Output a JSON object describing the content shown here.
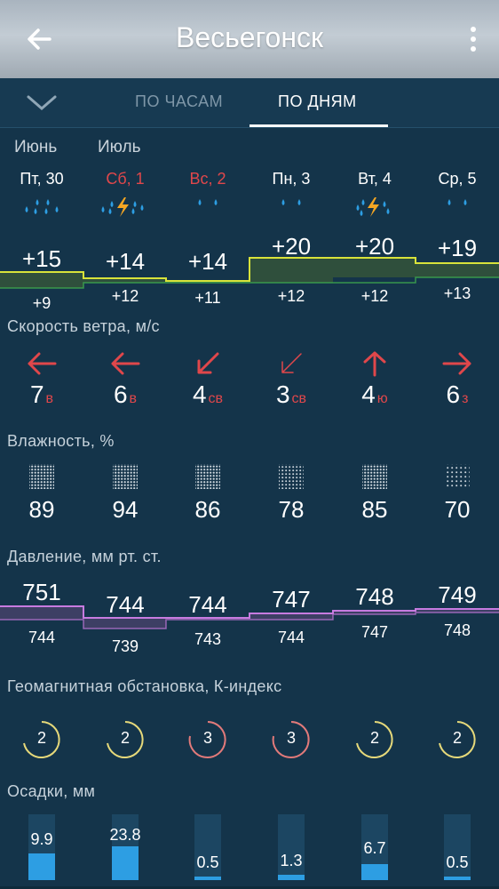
{
  "header": {
    "title": "Весьегонск"
  },
  "tabs": [
    {
      "label": "ПО ЧАСАМ",
      "active": false
    },
    {
      "label": "ПО ДНЯМ",
      "active": true
    }
  ],
  "months": [
    "Июнь",
    "Июль"
  ],
  "days": [
    {
      "label": "Пт, 30",
      "weekend": false,
      "icon": "rain-icon"
    },
    {
      "label": "Сб, 1",
      "weekend": true,
      "icon": "thunderstorm-rain-icon"
    },
    {
      "label": "Вс, 2",
      "weekend": true,
      "icon": "light-rain-icon"
    },
    {
      "label": "Пн, 3",
      "weekend": false,
      "icon": "light-rain-icon"
    },
    {
      "label": "Вт, 4",
      "weekend": false,
      "icon": "thunderstorm-rain-icon"
    },
    {
      "label": "Ср, 5",
      "weekend": false,
      "icon": "light-rain-icon"
    }
  ],
  "temperature": {
    "max": [
      "+15",
      "+14",
      "+14",
      "+20",
      "+20",
      "+19"
    ],
    "min": [
      "+9",
      "+12",
      "+11",
      "+12",
      "+12",
      "+13"
    ]
  },
  "wind": {
    "title": "Скорость ветра, м/с",
    "items": [
      {
        "speed": "7",
        "dir": "в",
        "icon": "arrow-left-icon"
      },
      {
        "speed": "6",
        "dir": "в",
        "icon": "arrow-left-icon"
      },
      {
        "speed": "4",
        "dir": "св",
        "icon": "arrow-down-left-icon"
      },
      {
        "speed": "3",
        "dir": "св",
        "icon": "arrow-down-left-thin-icon"
      },
      {
        "speed": "4",
        "dir": "ю",
        "icon": "arrow-up-icon"
      },
      {
        "speed": "6",
        "dir": "з",
        "icon": "arrow-right-icon"
      }
    ]
  },
  "humidity": {
    "title": "Влажность, %",
    "values": [
      "89",
      "94",
      "86",
      "78",
      "85",
      "70"
    ]
  },
  "pressure": {
    "title": "Давление, мм рт. ст.",
    "max": [
      "751",
      "744",
      "744",
      "747",
      "748",
      "749"
    ],
    "min": [
      "744",
      "739",
      "743",
      "744",
      "747",
      "748"
    ]
  },
  "geomagnetic": {
    "title": "Геомагнитная обстановка, К-индекс",
    "values": [
      "2",
      "2",
      "3",
      "3",
      "2",
      "2"
    ]
  },
  "precipitation": {
    "title": "Осадки, мм",
    "values": [
      "9.9",
      "23.8",
      "0.5",
      "1.3",
      "6.7",
      "0.5"
    ]
  },
  "colors": {
    "background": "#14344a",
    "weekend": "#e0474b",
    "temp_band": "#2f4f3c",
    "temp_line": "#d8e23a",
    "pressure_band": "#3d3f64",
    "pressure_line": "#c77be0",
    "rain": "#2d9ee3",
    "kp_calm": "#e6d97a",
    "kp_unsettled": "#e27a7a"
  }
}
